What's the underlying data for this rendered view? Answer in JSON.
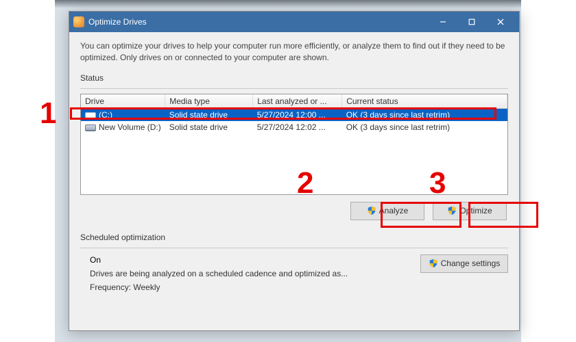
{
  "window": {
    "title": "Optimize Drives"
  },
  "intro": "You can optimize your drives to help your computer run more efficiently, or analyze them to find out if they need to be optimized. Only drives on or connected to your computer are shown.",
  "status": {
    "legend": "Status",
    "headers": {
      "drive": "Drive",
      "media": "Media type",
      "last": "Last analyzed or ...",
      "status": "Current status"
    },
    "rows": [
      {
        "name": "(C:)",
        "media": "Solid state drive",
        "last": "5/27/2024 12:00 ...",
        "status": "OK (3 days since last retrim)",
        "selected": true
      },
      {
        "name": "New Volume (D:)",
        "media": "Solid state drive",
        "last": "5/27/2024 12:02 ...",
        "status": "OK (3 days since last retrim)",
        "selected": false
      }
    ]
  },
  "buttons": {
    "analyze": "Analyze",
    "optimize": "Optimize",
    "change_settings": "Change settings"
  },
  "scheduled": {
    "legend": "Scheduled optimization",
    "state": "On",
    "desc": "Drives are being analyzed on a scheduled cadence and optimized as...",
    "frequency_label": "Frequency:",
    "frequency_value": "Weekly"
  },
  "annotations": {
    "num1": "1",
    "num2": "2",
    "num3": "3"
  }
}
